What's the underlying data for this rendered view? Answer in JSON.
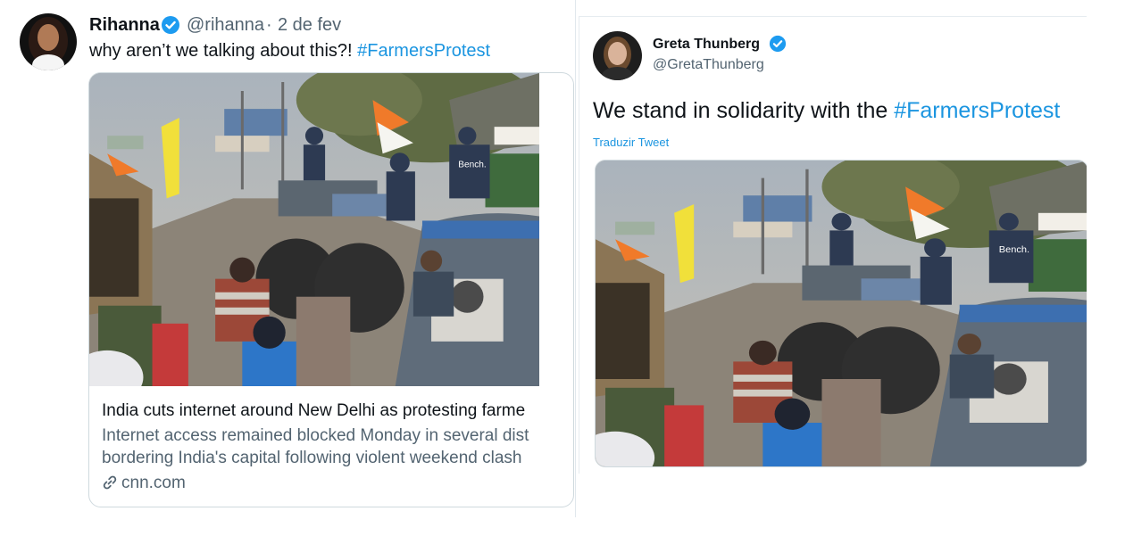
{
  "left_tweet": {
    "author_name": "Rihanna",
    "handle": "@rihanna",
    "separator": "·",
    "date": "2 de fev",
    "text_plain": "why aren’t we talking about this?! ",
    "hashtag": "#FarmersProtest",
    "card": {
      "title": "India cuts internet around New Delhi as protesting farme",
      "desc_line1": "Internet access remained blocked Monday in several dist",
      "desc_line2": "bordering India's capital following violent weekend clash",
      "domain": "cnn.com"
    }
  },
  "right_tweet": {
    "author_name": "Greta Thunberg",
    "handle": "@GretaThunberg",
    "text_plain": "We stand in solidarity with the ",
    "hashtag": "#FarmersProtest",
    "translate_label": "Traduzir Tweet"
  },
  "colors": {
    "link_blue": "#1b95e0",
    "verified_blue": "#1d9bf0",
    "text_dark": "#0f1419",
    "text_muted": "#536471"
  },
  "photo_sign_text": "Bench."
}
